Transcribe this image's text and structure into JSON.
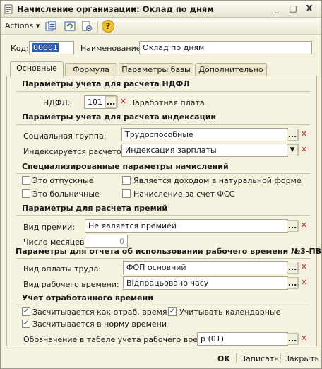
{
  "window": {
    "title": "Начисление организации: Оклад по дням",
    "minimize_glyph": "_",
    "maximize_glyph": "□",
    "close_glyph": "X"
  },
  "toolbar": {
    "actions_label": "Actions",
    "actions_arrow": "▾",
    "icons": [
      "copy-list-icon",
      "refresh-icon",
      "document-settings-icon",
      "help-icon"
    ],
    "help_glyph": "?"
  },
  "header": {
    "code_label": "Код:",
    "code_value": "00001",
    "name_label": "Наименование:",
    "name_value": "Оклад по дням"
  },
  "tabs": [
    "Основные",
    "Формула",
    "Параметры базы",
    "Дополнительно"
  ],
  "ndfl": {
    "section": "Параметры учета для расчета НДФЛ",
    "label": "НДФЛ:",
    "code": "101",
    "description": "Заработная плата"
  },
  "indexation": {
    "section": "Параметры учета для расчета индексации",
    "social_group_label": "Социальная группа:",
    "social_group_value": "Трудоспособные",
    "indexed_by_label": "Индексируется расчетом:",
    "indexed_by_value": "Индексация зарплаты"
  },
  "special": {
    "section": "Специализированные параметры начислений",
    "vacation_label": "Это отпускные",
    "vacation_checked": false,
    "sick_label": "Это больничные",
    "sick_checked": false,
    "in_kind_label": "Является доходом в натуральной форме",
    "in_kind_checked": false,
    "fss_label": "Начисление за счет ФСС",
    "fss_checked": false
  },
  "bonus": {
    "section": "Параметры для расчета премий",
    "type_label": "Вид премии:",
    "type_value": "Не является премией",
    "months_label": "Число месяцев:",
    "months_value": "0"
  },
  "report": {
    "section": "Параметры для отчета об использовании рабочего времени №3-ПВ",
    "pay_type_label": "Вид оплаты труда:",
    "pay_type_value": "ФОП основний",
    "work_time_label": "Вид рабочего времени:",
    "work_time_value": "Відпрацьовано часу"
  },
  "worked_time": {
    "section": "Учет отработанного времени",
    "counts_as_worked_label": "Засчитывается как отраб. время",
    "counts_as_worked_checked": true,
    "calendar_label": "Учитывать календарные",
    "calendar_checked": true,
    "counts_norm_label": "Засчитывается в норму времени",
    "counts_norm_checked": true,
    "timesheet_label": "Обозначение в табеле учета рабочего времени:",
    "timesheet_value": "р (01)"
  },
  "footer": {
    "ok_label": "OK",
    "save_label": "Записать",
    "close_label": "Закрыть"
  },
  "controls": {
    "select_glyph": "...",
    "clear_glyph": "✕",
    "dropdown_glyph": "▼",
    "check_glyph": "✓"
  },
  "colors": {
    "window_bg": "#f6f2e0",
    "accent_yellow": "#f2c12e",
    "clear_red": "#c0271f",
    "selected_code_bg": "#2f5fb3"
  }
}
